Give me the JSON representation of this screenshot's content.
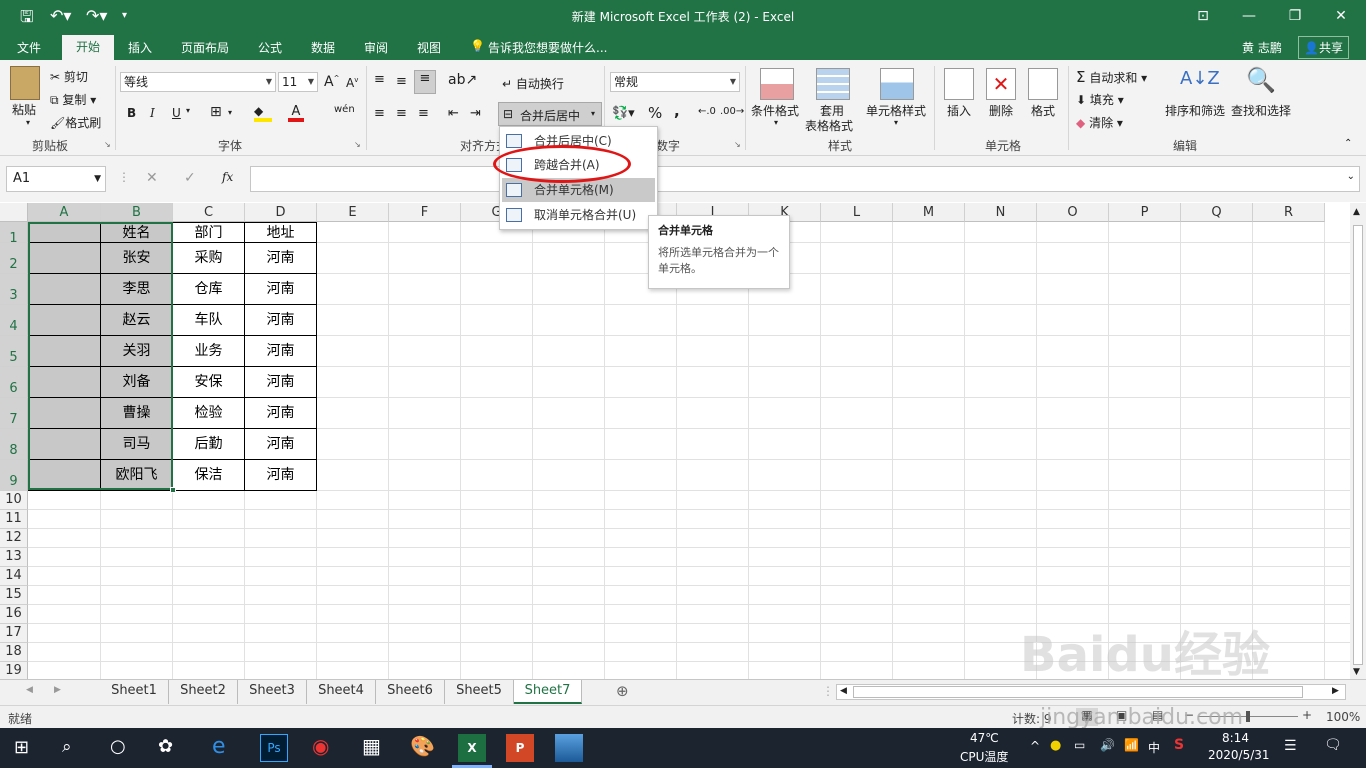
{
  "window": {
    "title": "新建 Microsoft Excel 工作表 (2) - Excel",
    "user": "黄 志鹏",
    "share": "共享"
  },
  "tabs": [
    "文件",
    "开始",
    "插入",
    "页面布局",
    "公式",
    "数据",
    "审阅",
    "视图"
  ],
  "tell_me": "告诉我您想要做什么...",
  "ribbon": {
    "clipboard": {
      "paste": "粘贴",
      "cut": "剪切",
      "copy": "复制",
      "format_painter": "格式刷",
      "label": "剪贴板"
    },
    "font": {
      "name": "等线",
      "size": "11",
      "bold": "B",
      "italic": "I",
      "underline": "U",
      "label": "字体"
    },
    "align": {
      "wrap": "自动换行",
      "merge": "合并后居中",
      "label": "对齐方式"
    },
    "number": {
      "format": "常规",
      "percent": "%",
      "comma": ",",
      "label": "数字"
    },
    "styles": {
      "cond": "条件格式",
      "table_1": "套用",
      "table_2": "表格格式",
      "cell": "单元格样式",
      "label": "样式"
    },
    "cells": {
      "insert": "插入",
      "delete": "删除",
      "format": "格式",
      "label": "单元格"
    },
    "editing": {
      "autosum": "自动求和",
      "fill": "填充",
      "clear": "清除",
      "sort": "排序和筛选",
      "find": "查找和选择",
      "label": "编辑"
    }
  },
  "merge_menu": [
    "合并后居中(C)",
    "跨越合并(A)",
    "合并单元格(M)",
    "取消单元格合并(U)"
  ],
  "tooltip": {
    "title": "合并单元格",
    "body": "将所选单元格合并为一个单元格。"
  },
  "formula_bar": {
    "name_box": "A1",
    "fx": "fx"
  },
  "columns": [
    "A",
    "B",
    "C",
    "D",
    "E",
    "F",
    "G",
    "H",
    "I",
    "J",
    "K",
    "L",
    "M",
    "N",
    "O",
    "P",
    "Q",
    "R"
  ],
  "rows": [
    "1",
    "2",
    "3",
    "4",
    "5",
    "6",
    "7",
    "8",
    "9",
    "10",
    "11",
    "12",
    "13",
    "14",
    "15",
    "16",
    "17",
    "18",
    "19"
  ],
  "table": {
    "headers": [
      "姓名",
      "部门",
      "地址"
    ],
    "rows": [
      [
        "张安",
        "采购",
        "河南"
      ],
      [
        "李思",
        "仓库",
        "河南"
      ],
      [
        "赵云",
        "车队",
        "河南"
      ],
      [
        "关羽",
        "业务",
        "河南"
      ],
      [
        "刘备",
        "安保",
        "河南"
      ],
      [
        "曹操",
        "检验",
        "河南"
      ],
      [
        "司马",
        "后勤",
        "河南"
      ],
      [
        "欧阳飞",
        "保洁",
        "河南"
      ]
    ]
  },
  "sheets": [
    "Sheet1",
    "Sheet2",
    "Sheet3",
    "Sheet4",
    "Sheet6",
    "Sheet5",
    "Sheet7"
  ],
  "active_sheet": "Sheet7",
  "status": {
    "ready": "就绪",
    "count": "计数: 9",
    "zoom": "100%"
  },
  "taskbar": {
    "temp": "47℃",
    "temp_label": "CPU温度",
    "time": "8:14",
    "date": "2020/5/31",
    "ime": "中"
  },
  "watermark": {
    "logo": "Baidu经验",
    "url": "jingyan.baidu.com"
  },
  "colors": {
    "excel_green": "#217346",
    "accent_red": "#e01515"
  }
}
